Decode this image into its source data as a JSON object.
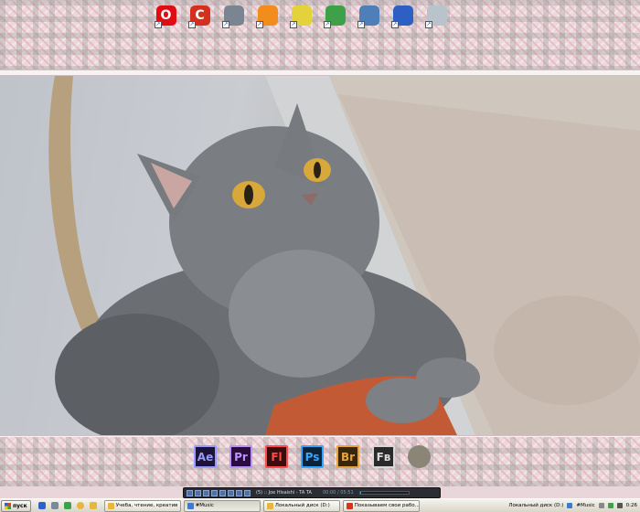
{
  "top_dock": [
    {
      "name": "opera-icon",
      "glyph": "O",
      "color": "#e10c11"
    },
    {
      "name": "ccleaner-icon",
      "glyph": "C",
      "color": "#d5301e"
    },
    {
      "name": "printer-icon",
      "glyph": "",
      "color": "#7b8591"
    },
    {
      "name": "windows-media-icon",
      "glyph": "",
      "color": "#f28c1c"
    },
    {
      "name": "books-icon",
      "glyph": "",
      "color": "#e4d23a"
    },
    {
      "name": "network-globe-icon",
      "glyph": "",
      "color": "#3fa04a"
    },
    {
      "name": "search-icon",
      "glyph": "",
      "color": "#4f7fb8"
    },
    {
      "name": "computer-icon",
      "glyph": "",
      "color": "#2e5fc2"
    },
    {
      "name": "recycle-bin-icon",
      "glyph": "",
      "color": "#b9c3cc"
    }
  ],
  "bottom_dock": [
    {
      "name": "after-effects-icon",
      "label": "Ae",
      "color": "#9999ff",
      "bg": "#1b1438"
    },
    {
      "name": "premiere-icon",
      "label": "Pr",
      "color": "#b992ff",
      "bg": "#2a0d3c"
    },
    {
      "name": "flash-icon",
      "label": "Fl",
      "color": "#ff4a4a",
      "bg": "#3c0b0b"
    },
    {
      "name": "photoshop-icon",
      "label": "Ps",
      "color": "#31a8ff",
      "bg": "#0b2239"
    },
    {
      "name": "bridge-icon",
      "label": "Br",
      "color": "#e8a33d",
      "bg": "#3a2608"
    },
    {
      "name": "fireworks-icon",
      "label": "Fв",
      "color": "#d9d9d9",
      "bg": "#2a2a2a"
    },
    {
      "name": "gimp-icon",
      "label": "",
      "color": "#888888",
      "bg": "transparent"
    }
  ],
  "player": {
    "track": "(5) :: Joe Hisaishi - TA TA",
    "time": "00:00 / 05:51",
    "progress": 0.02
  },
  "taskbar": {
    "start_label": "пуск",
    "tasks": [
      {
        "label": "Учеба, чтение, креатив",
        "color": "#e6b640"
      },
      {
        "label": "#Music",
        "color": "#3b7bd4"
      },
      {
        "label": "Локальный диск (D:)",
        "color": "#e6b640"
      },
      {
        "label": "Показываем свои рабо...",
        "color": "#d6341c"
      }
    ],
    "tray": {
      "drive_label": "Локальный диск (D:)",
      "music_label": "#Music",
      "clock": "0:26"
    }
  },
  "colors": {
    "plaid_pink": "#ead9dc",
    "taskbar": "#ece9d8"
  }
}
